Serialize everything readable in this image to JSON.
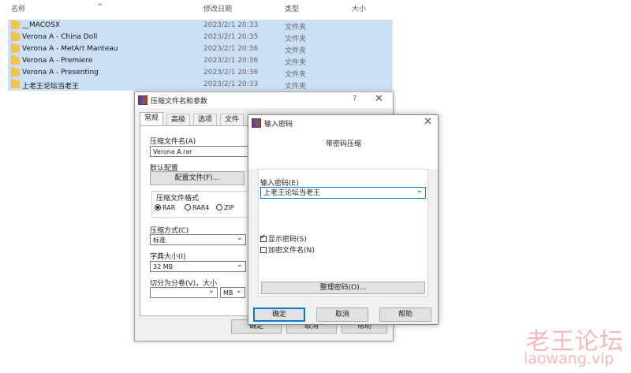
{
  "explorer": {
    "columns": {
      "name": "名称",
      "date": "修改日期",
      "type": "类型",
      "size": "大小"
    },
    "sort_caret": "^",
    "rows": [
      {
        "name": "__MACOSX",
        "date": "2023/2/1 20:33",
        "type": "文件夹"
      },
      {
        "name": "Verona A - China Doll",
        "date": "2023/2/1 20:35",
        "type": "文件夹"
      },
      {
        "name": "Verona A - MetArt Manteau",
        "date": "2023/2/1 20:36",
        "type": "文件夹"
      },
      {
        "name": "Verona A - Premiere",
        "date": "2023/2/1 20:36",
        "type": "文件夹"
      },
      {
        "name": "Verona A - Presenting",
        "date": "2023/2/1 20:36",
        "type": "文件夹"
      },
      {
        "name": "上老王论坛当老王",
        "date": "2023/2/1 20:33",
        "type": "文件夹"
      }
    ]
  },
  "archive_dialog": {
    "title": "压缩文件名和参数",
    "help_glyph": "?",
    "close_glyph": "✕",
    "tabs": [
      "常规",
      "高级",
      "选项",
      "文件"
    ],
    "archive_name_label": "压缩文件名(A)",
    "archive_name_value": "Verona A.rar",
    "default_profile_label": "默认配置",
    "profile_button": "配置文件(F)...",
    "format_group_label": "压缩文件格式",
    "formats": [
      "RAR",
      "RAR4",
      "ZIP"
    ],
    "selected_format": "RAR",
    "method_label": "压缩方式(C)",
    "method_value": "标准",
    "dict_label": "字典大小(I)",
    "dict_value": "32 MB",
    "split_label": "切分为分卷(V)，大小",
    "split_unit": "MB",
    "ok_partial": "确定",
    "cancel_partial": "取消",
    "help_partial": "帮助"
  },
  "password_dialog": {
    "title": "输入密码",
    "close_glyph": "✕",
    "heading": "带密码压缩",
    "password_label": "输入密码(E)",
    "password_value": "上老王论坛当老王",
    "show_password_label": "显示密码(S)",
    "show_password_checked": true,
    "encrypt_names_label": "加密文件名(N)",
    "encrypt_names_checked": false,
    "organize_button": "整理密码(O)...",
    "ok": "确定",
    "cancel": "取消",
    "help": "帮助"
  },
  "watermark": {
    "text_cn": "老王论坛",
    "text_url": "laowang.vip"
  },
  "colors": {
    "selection": "#cce0f5",
    "folder": "#f4c34d",
    "accent": "#0078d7",
    "watermark": "#f3b9b9"
  }
}
